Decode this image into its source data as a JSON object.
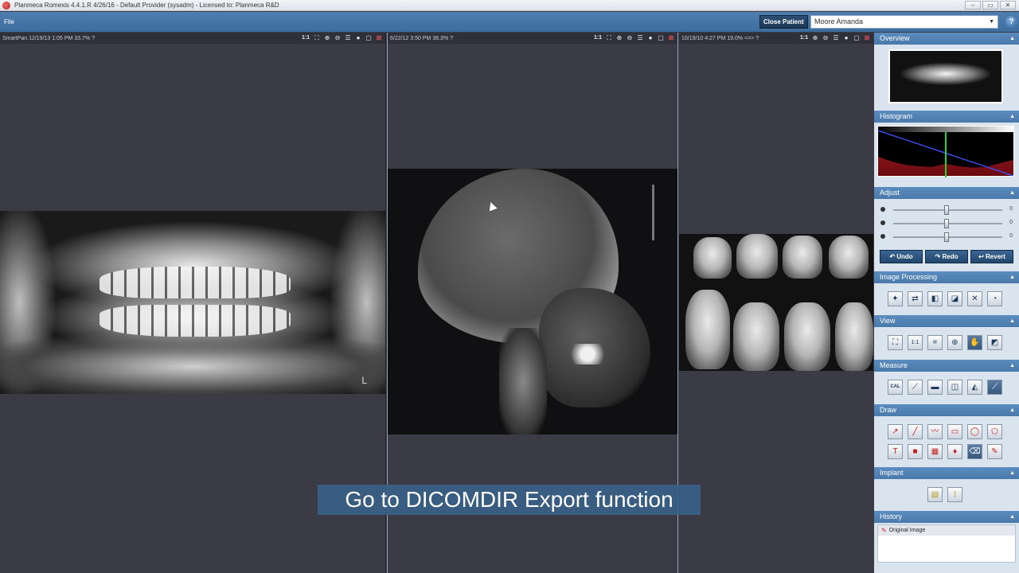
{
  "window": {
    "title": "Planmeca Romexis 4.4.1.R  4/26/16 - Default Provider (sysadm) - Licensed to: Planmeca R&D",
    "minimize": "–",
    "maximize": "▭",
    "close": "✕"
  },
  "menu": {
    "file": "File",
    "close_patient": "Close Patient",
    "patient_name": "Moore Amanda",
    "help": "?"
  },
  "viewports": [
    {
      "info": "SmartPan 12/19/13 1:05 PM  33.7%  ?",
      "zoom_label": "1:1"
    },
    {
      "info": "6/22/12 3:50 PM  36.3%  ?",
      "zoom_label": "1:1"
    },
    {
      "info": "10/19/10 4:27 PM  19.0%  <=> ?",
      "zoom_label": "1:1"
    }
  ],
  "viewport_tool_glyphs": {
    "fit": "⛶",
    "zoom_in": "⊕",
    "zoom_out": "⊖",
    "list": "☰",
    "comment": "●",
    "maximize": "▢",
    "close": "⊠"
  },
  "pan_marker": "L",
  "caption": "Go to DICOMDIR Export function",
  "panel": {
    "overview": "Overview",
    "histogram": "Histogram",
    "adjust": "Adjust",
    "slider_values": [
      "0",
      "0",
      "0"
    ],
    "undo": "Undo",
    "redo": "Redo",
    "revert": "Revert",
    "image_processing": "Image Processing",
    "view": "View",
    "view_one_to_one": "1:1",
    "measure": "Measure",
    "measure_cal": "CAL",
    "draw": "Draw",
    "implant": "Implant",
    "history": "History",
    "history_items": [
      "Original Image"
    ]
  },
  "colors": {
    "accent": "#4a7aab",
    "panel_bg": "#d9e4ef",
    "viewport_bg": "#3a3b45",
    "close_red": "#ff5a5a"
  }
}
